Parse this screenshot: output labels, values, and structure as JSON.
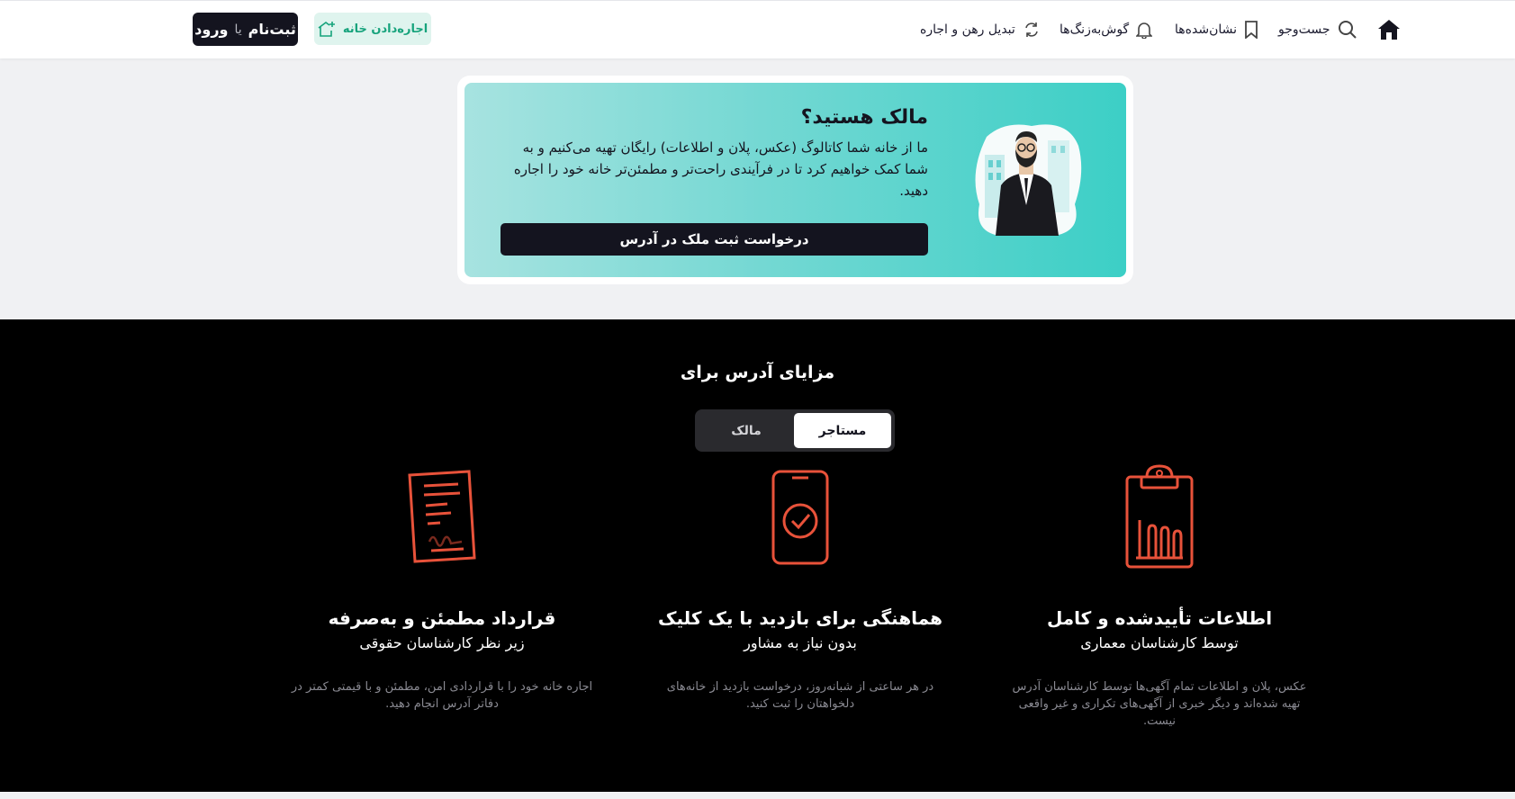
{
  "header": {
    "nav": [
      {
        "label": "جست‌وجو",
        "icon": "search-icon"
      },
      {
        "label": "نشان‌شده‌ها",
        "icon": "bookmark-icon"
      },
      {
        "label": "گوش‌به‌زنگ‌ها",
        "icon": "bell-icon"
      },
      {
        "label": "تبدیل رهن و اجاره",
        "icon": "convert-icon"
      }
    ],
    "rent_button": "اجاره‌دادن خانه",
    "login": {
      "signup": "ثبت‌نام",
      "or": "یا",
      "login": "ورود"
    }
  },
  "owner_card": {
    "title": "مالک هستید؟",
    "description": "ما از خانه شما کاتالوگ (عکس، پلان و اطلاعات) رایگان تهیه می‌کنیم و به شما کمک خواهیم کرد تا در فرآیندی راحت‌تر و مطمئن‌تر خانه خود را اجاره دهید.",
    "button": "درخواست ثبت ملک در آدرس"
  },
  "advantages": {
    "title": "مزایای آدرس برای",
    "tabs": {
      "active": "مستاجر",
      "inactive": "مالک"
    },
    "features": [
      {
        "title": "اطلاعات تأییدشده و کامل",
        "subtitle": "توسط کارشناسان معماری",
        "description": "عکس، پلان و اطلاعات تمام آگهی‌ها توسط کارشناسان آدرس تهیه شده‌اند و دیگر خبری از آگهی‌های تکراری و غیر واقعی نیست.",
        "icon": "clipboard-chart-icon"
      },
      {
        "title": "هماهنگی برای بازدید با یک کلیک",
        "subtitle": "بدون نیاز به مشاور",
        "description": "در هر ساعتی از شبانه‌روز، درخواست بازدید از خانه‌های دلخواهتان را ثبت کنید.",
        "icon": "phone-check-icon"
      },
      {
        "title": "قرارداد مطمئن و به‌صرفه",
        "subtitle": "زیر نظر کارشناسان حقوقی",
        "description": "اجاره خانه خود را با قراردادی امن، مطمئن و با قیمتی کمتر در دفاتر آدرس انجام دهید.",
        "icon": "contract-icon"
      }
    ]
  },
  "colors": {
    "accent": "#e8523a",
    "dark": "#14141f",
    "teal": "#3ccfc6",
    "rent_green": "#16a37c"
  }
}
